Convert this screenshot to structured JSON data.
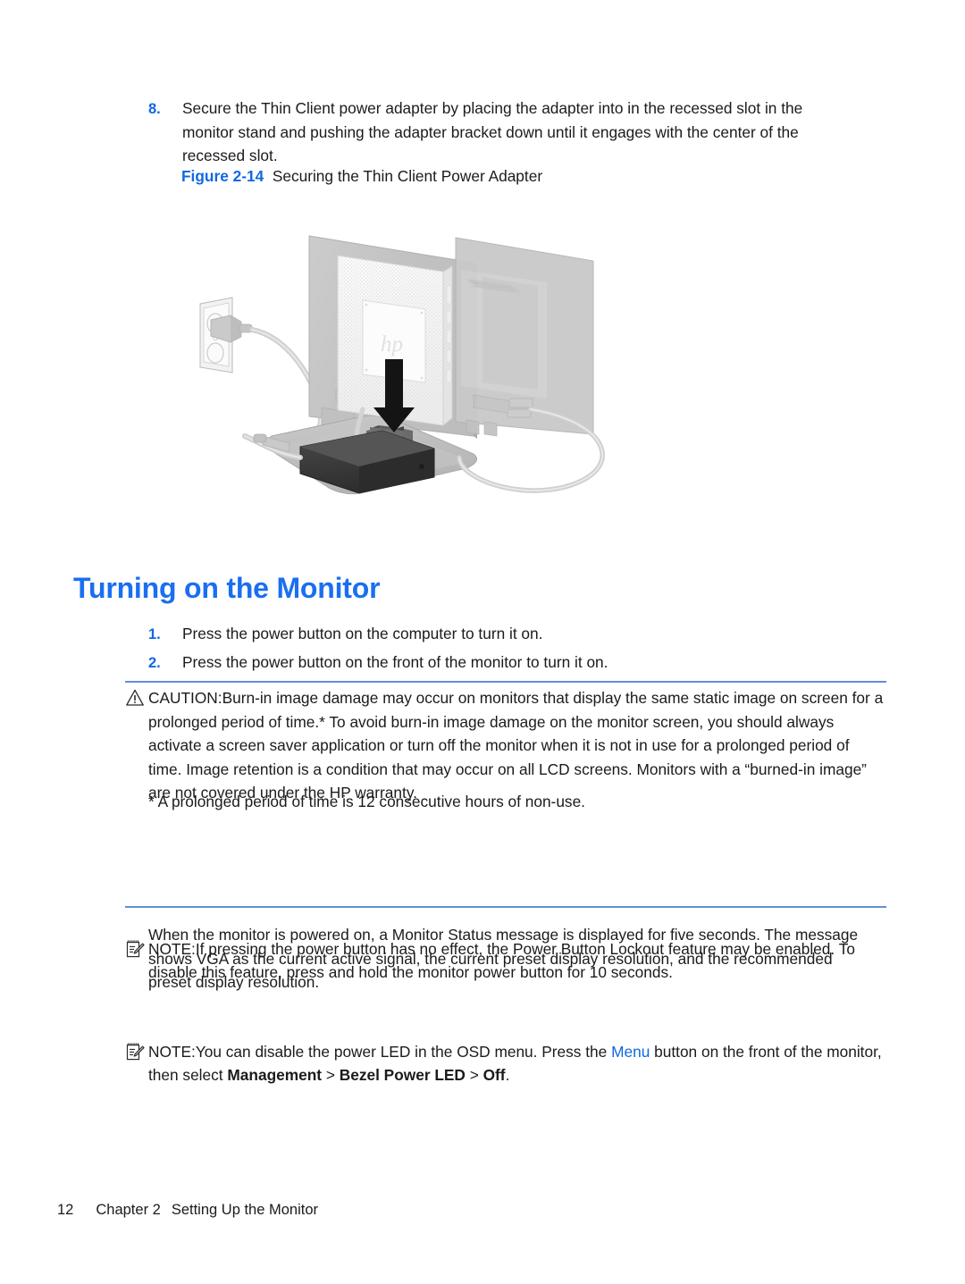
{
  "document": {
    "step8": {
      "number": "8.",
      "text": "Secure the Thin Client power adapter by placing the adapter into in the recessed slot in the monitor stand and pushing the adapter bracket down until it engages with the center of the recessed slot."
    },
    "figure": {
      "label": "Figure 2-14",
      "title": "Securing the Thin Client Power Adapter",
      "alt": "Illustration of a monitor seen from behind with a thin client mounted on its back, an AC adapter being pressed down into the recessed slot of the monitor stand, and a power cord running to a wall outlet. A downward black arrow indicates the direction to push the adapter."
    },
    "section": {
      "heading": "Turning on the Monitor",
      "steps": [
        {
          "number": "1.",
          "text": "Press the power button on the computer to turn it on."
        },
        {
          "number": "2.",
          "text": "Press the power button on the front of the monitor to turn it on."
        }
      ]
    },
    "caution": {
      "icon": "warning-triangle-icon",
      "label": "CAUTION:",
      "text": "Burn-in image damage may occur on monitors that display the same static image on screen for a prolonged period of time.* To avoid burn-in image damage on the monitor screen, you should always activate a screen saver application or turn off the monitor when it is not in use for a prolonged period of time. Image retention is a condition that may occur on all LCD screens. Monitors with a “burned-in image” are not covered under the HP warranty."
    },
    "footnote": {
      "text": "* A prolonged period of time is 12 consecutive hours of non-use."
    },
    "notes": [
      {
        "icon": "notepad-pencil-icon",
        "label": "NOTE:",
        "text": "If pressing the power button has no effect, the Power Button Lockout feature may be enabled. To disable this feature, press and hold the monitor power button for 10 seconds."
      },
      {
        "icon": "notepad-pencil-icon",
        "label": "NOTE:",
        "text_part1": "You can disable the power LED in the OSD menu. Press the ",
        "link": "Menu",
        "text_part2": " button on the front of the monitor, then select ",
        "bold1": "Management",
        "sep1": " > ",
        "bold2": "Bezel Power LED",
        "sep2": " > ",
        "bold3": "Off",
        "text_part3": "."
      }
    ],
    "closing_paragraph": {
      "text": "When the monitor is powered on, a Monitor Status message is displayed for five seconds. The message shows VGA as the current active signal, the current preset display resolution, and the recommended preset display resolution."
    },
    "footer": {
      "page_number": "12",
      "chapter": "Chapter 2",
      "chapter_title": "Setting Up the Monitor"
    },
    "colors": {
      "accent_blue": "#1168e2",
      "heading_blue": "#1a6ff0",
      "rule_blue": "#5f8fd6",
      "body_black": "#1b1b1b"
    }
  }
}
